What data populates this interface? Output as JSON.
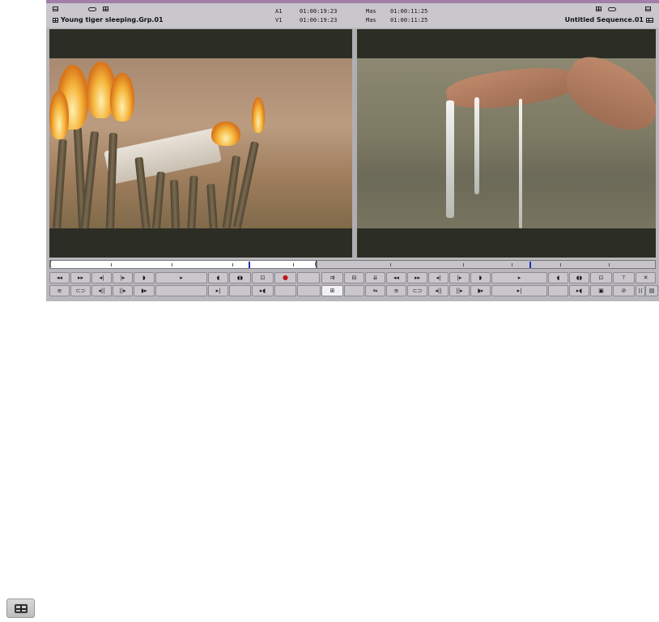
{
  "source": {
    "clip_name": "Young tiger sleeping.Grp.01",
    "track_a1": "A1",
    "tc_a1": "01:00:19:23",
    "track_v1": "V1",
    "tc_v1": "01:00:19:23"
  },
  "record": {
    "sequence_name": "Untitled Sequence.01",
    "label_1": "Mas",
    "tc_1": "01:00:11:25",
    "label_2": "Mas",
    "tc_2": "01:00:11:25"
  },
  "colors": {
    "top_strip": "#a27fa7",
    "position_indicator": "#2030c0",
    "mark_clip_red": "#c01818"
  },
  "buttons": {
    "row1": [
      "rewind-icon",
      "fast-forward-icon",
      "step-back-icon",
      "step-forward-icon",
      "play-reverse-icon",
      "play-icon",
      "mark-in-icon",
      "mark-in-out-icon",
      "clear-marks-icon",
      "add-marker-icon",
      "",
      "splice-in-icon",
      "lift-icon",
      "overwrite-icon",
      "rewind-icon",
      "fast-forward-icon",
      "step-back-icon",
      "step-forward-icon",
      "play-reverse-icon",
      "play-icon",
      "mark-in-icon",
      "mark-in-out-icon",
      "clear-marks-icon",
      "trim-icon",
      "close-icon"
    ],
    "row2": [
      "menu-icon",
      "link-icon",
      "step-back-10-icon",
      "step-forward-10-icon",
      "go-to-out-icon",
      "",
      "go-to-in-icon",
      "",
      "match-frame-icon",
      "",
      "",
      "toggle-source-icon",
      "",
      "sync-icon",
      "menu-icon",
      "link-icon",
      "step-back-10-icon",
      "step-forward-10-icon",
      "go-to-out-icon",
      "go-to-in-icon",
      "",
      "match-frame-icon",
      "mark-clip-icon",
      "delete-icon",
      "replace-icon",
      "copy-icon"
    ]
  }
}
